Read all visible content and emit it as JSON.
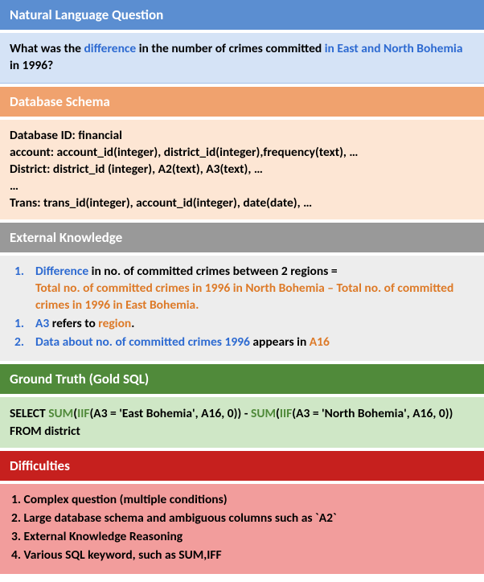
{
  "nlq": {
    "header": "Natural Language Question",
    "q_pre": "What was the ",
    "q_diff": "difference",
    "q_mid": " in the number of crimes committed ",
    "q_loc": "in East and North Bohemia",
    "q_post": " in 1996?"
  },
  "schema": {
    "header": "Database Schema",
    "l1": "Database ID: financial",
    "l2": "account: account_id(integer), district_id(integer),frequency(text),  …",
    "l3": "District: district_id (integer), A2(text),  A3(text),  …",
    "l4": "…",
    "l5": "Trans: trans_id(integer), account_id(integer), date(date),  …"
  },
  "ext": {
    "header": "External Knowledge",
    "n1": "1.",
    "n2": "1.",
    "n3": "2.",
    "i1a": "Difference",
    "i1b": " in no. of committed crimes between 2 regions = ",
    "i1c": "Total no. of committed crimes in 1996 in North Bohemia – Total no. of committed crimes in 1996 in East Bohemia.",
    "i2a": "A3",
    "i2b": " refers to ",
    "i2c": "region",
    "i2d": ".",
    "i3a": "Data about no. of committed crimes 1996",
    "i3b": " appears in ",
    "i3c": "A16"
  },
  "gt": {
    "header": "Ground Truth (Gold SQL)",
    "p1": "SELECT ",
    "p2": "SUM",
    "p3": "(",
    "p4": "IIF",
    "p5": "(A3 = 'East Bohemia', A16, 0)) - ",
    "p6": "SUM",
    "p7": "(",
    "p8": "IIF",
    "p9": "(A3 = 'North Bohemia', A16, 0)) FROM district"
  },
  "diff": {
    "header": "Difficulties",
    "i1": "1. Complex question (multiple conditions)",
    "i2": "2. Large database schema and ambiguous columns such as `A2`",
    "i3": "3. External Knowledge Reasoning",
    "i4": "4. Various SQL keyword, such as SUM,IFF"
  }
}
